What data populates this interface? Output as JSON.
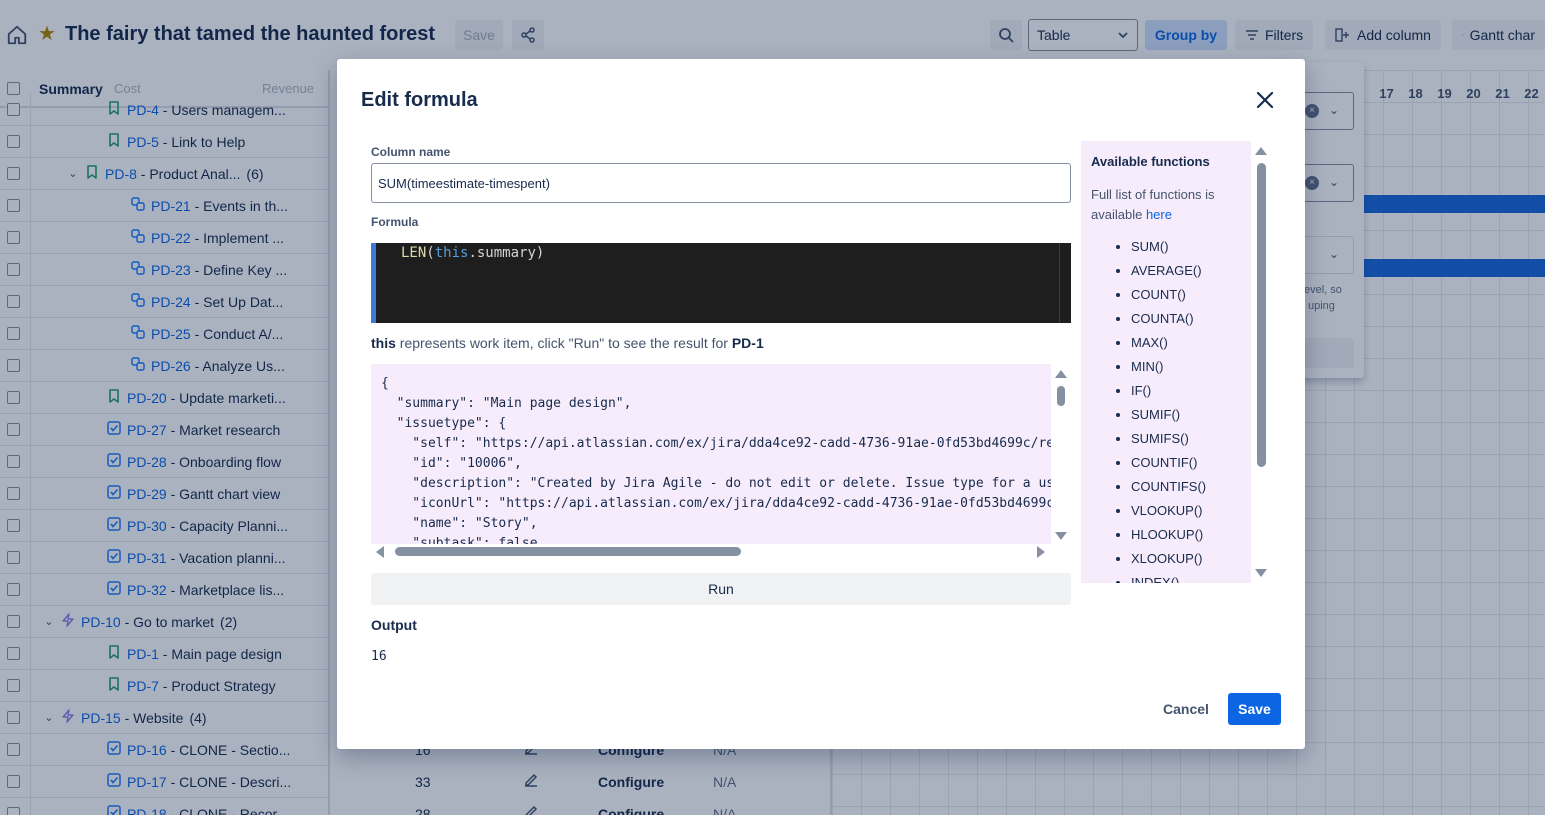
{
  "topbar": {
    "title": "The fairy that tamed the haunted forest",
    "save_label": "Save",
    "view_select": "Table",
    "group_by": "Group by",
    "filters": "Filters",
    "add_column": "Add column",
    "gantt": "Gantt char"
  },
  "table": {
    "headers": {
      "summary": "Summary",
      "cost": "Cost",
      "revenue": "Revenue"
    },
    "rows": [
      {
        "key": "PD-4",
        "title": " - Users managem...",
        "count": "",
        "indent": 3,
        "icon": "story-icon",
        "chevron": ""
      },
      {
        "key": "PD-5",
        "title": " - Link to Help",
        "count": "",
        "indent": 3,
        "icon": "story-icon",
        "chevron": ""
      },
      {
        "key": "PD-8",
        "title": " - Product Anal...",
        "count": "(6)",
        "indent": 2,
        "icon": "story-icon",
        "chevron": "v"
      },
      {
        "key": "PD-21",
        "title": " - Events in th...",
        "count": "",
        "indent": 4,
        "icon": "subtask-icon",
        "chevron": ""
      },
      {
        "key": "PD-22",
        "title": " - Implement ...",
        "count": "",
        "indent": 4,
        "icon": "subtask-icon",
        "chevron": ""
      },
      {
        "key": "PD-23",
        "title": " - Define Key ...",
        "count": "",
        "indent": 4,
        "icon": "subtask-icon",
        "chevron": ""
      },
      {
        "key": "PD-24",
        "title": " - Set Up Dat...",
        "count": "",
        "indent": 4,
        "icon": "subtask-icon",
        "chevron": ""
      },
      {
        "key": "PD-25",
        "title": " - Conduct A/...",
        "count": "",
        "indent": 4,
        "icon": "subtask-icon",
        "chevron": ""
      },
      {
        "key": "PD-26",
        "title": " - Analyze Us...",
        "count": "",
        "indent": 4,
        "icon": "subtask-icon",
        "chevron": ""
      },
      {
        "key": "PD-20",
        "title": " - Update marketi...",
        "count": "",
        "indent": 3,
        "icon": "story-icon",
        "chevron": ""
      },
      {
        "key": "PD-27",
        "title": " - Market research",
        "count": "",
        "indent": 3,
        "icon": "task-icon",
        "chevron": ""
      },
      {
        "key": "PD-28",
        "title": " - Onboarding flow",
        "count": "",
        "indent": 3,
        "icon": "task-icon",
        "chevron": ""
      },
      {
        "key": "PD-29",
        "title": " - Gantt chart view",
        "count": "",
        "indent": 3,
        "icon": "task-icon",
        "chevron": ""
      },
      {
        "key": "PD-30",
        "title": " - Capacity Planni...",
        "count": "",
        "indent": 3,
        "icon": "task-icon",
        "chevron": ""
      },
      {
        "key": "PD-31",
        "title": " - Vacation planni...",
        "count": "",
        "indent": 3,
        "icon": "task-icon",
        "chevron": ""
      },
      {
        "key": "PD-32",
        "title": " - Marketplace lis...",
        "count": "",
        "indent": 3,
        "icon": "task-icon",
        "chevron": ""
      },
      {
        "key": "PD-10",
        "title": " - Go to market",
        "count": "(2)",
        "indent": 1,
        "icon": "epic-icon",
        "chevron": "v"
      },
      {
        "key": "PD-1",
        "title": " - Main page design",
        "count": "",
        "indent": 3,
        "icon": "story-icon",
        "chevron": ""
      },
      {
        "key": "PD-7",
        "title": " - Product Strategy",
        "count": "",
        "indent": 3,
        "icon": "story-icon",
        "chevron": ""
      },
      {
        "key": "PD-15",
        "title": " - Website",
        "count": "(4)",
        "indent": 1,
        "icon": "epic-icon",
        "chevron": "v"
      },
      {
        "key": "PD-16",
        "title": " - CLONE - Sectio...",
        "count": "",
        "indent": 3,
        "icon": "task-icon",
        "chevron": ""
      },
      {
        "key": "PD-17",
        "title": " - CLONE - Descri...",
        "count": "",
        "indent": 3,
        "icon": "task-icon",
        "chevron": ""
      },
      {
        "key": "PD-18",
        "title": " - CLONE - Recor...",
        "count": "",
        "indent": 3,
        "icon": "task-icon",
        "chevron": ""
      }
    ],
    "mid_rows": [
      {
        "num": "16",
        "configure": "Configure",
        "na": "N/A"
      },
      {
        "num": "33",
        "configure": "Configure",
        "na": "N/A"
      },
      {
        "num": "28",
        "configure": "Configure",
        "na": "N/A"
      }
    ]
  },
  "gantt": {
    "days": [
      "17",
      "18",
      "19",
      "20",
      "21",
      "22"
    ],
    "panel_text": [
      "evel, so",
      "uping"
    ]
  },
  "modal": {
    "title": "Edit formula",
    "column_name_label": "Column name",
    "column_name_value": "SUM(timeestimate-timespent)",
    "formula_label": "Formula",
    "formula_code": {
      "fn": "LEN",
      "open": "(",
      "kw": "this",
      "rest": ".summary)"
    },
    "hint": {
      "this_word": "this",
      "text": " represents work item, click \"Run\" to see the result for ",
      "issue": "PD-1"
    },
    "json_preview": "{\n  \"summary\": \"Main page design\",\n  \"issuetype\": {\n    \"self\": \"https://api.atlassian.com/ex/jira/dda4ce92-cadd-4736-91ae-0fd53bd4699c/res\n    \"id\": \"10006\",\n    \"description\": \"Created by Jira Agile - do not edit or delete. Issue type for a use\n    \"iconUrl\": \"https://api.atlassian.com/ex/jira/dda4ce92-cadd-4736-91ae-0fd53bd4699c/\n    \"name\": \"Story\",\n    \"subtask\": false,",
    "run_label": "Run",
    "output_label": "Output",
    "output_value": "16",
    "functions": {
      "title": "Available functions",
      "desc_prefix": "Full list of functions is available ",
      "link_text": "here",
      "items": [
        "SUM()",
        "AVERAGE()",
        "COUNT()",
        "COUNTA()",
        "MAX()",
        "MIN()",
        "IF()",
        "SUMIF()",
        "SUMIFS()",
        "COUNTIF()",
        "COUNTIFS()",
        "VLOOKUP()",
        "HLOOKUP()",
        "XLOOKUP()",
        "INDEX()"
      ]
    },
    "cancel_label": "Cancel",
    "save_label": "Save"
  },
  "colors": {
    "primary": "#0c66e4",
    "story": "#22a06b",
    "task": "#1d7afc",
    "epic": "#8f7ee7",
    "json_bg": "#f7ecfb"
  }
}
